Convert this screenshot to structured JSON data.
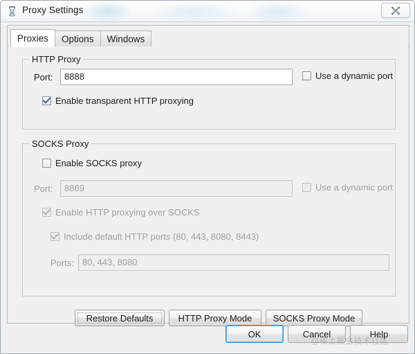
{
  "window": {
    "title": "Proxy Settings",
    "icon": "proxy-app-icon",
    "close_icon": "close-icon"
  },
  "tabs": [
    {
      "label": "Proxies",
      "active": true
    },
    {
      "label": "Options",
      "active": false
    },
    {
      "label": "Windows",
      "active": false
    }
  ],
  "http_proxy": {
    "group_title": "HTTP Proxy",
    "port_label": "Port:",
    "port_value": "8888",
    "dynamic_port": {
      "label": "Use a dynamic port",
      "checked": false,
      "enabled": true
    },
    "transparent": {
      "label": "Enable transparent HTTP proxying",
      "checked": true,
      "enabled": true
    }
  },
  "socks_proxy": {
    "group_title": "SOCKS Proxy",
    "enable": {
      "label": "Enable SOCKS proxy",
      "checked": false,
      "enabled": true
    },
    "port_label": "Port:",
    "port_value": "8889",
    "dynamic_port": {
      "label": "Use a dynamic port",
      "checked": false,
      "enabled": false
    },
    "http_over_socks": {
      "label": "Enable HTTP proxying over SOCKS",
      "checked": true,
      "enabled": false
    },
    "default_ports": {
      "label": "Include default HTTP ports (80, 443, 8080, 8443)",
      "checked": true,
      "enabled": false
    },
    "ports_label": "Ports:",
    "ports_value": "80, 443, 8080"
  },
  "mode_buttons": {
    "restore_defaults": "Restore Defaults",
    "http_proxy_mode": "HTTP Proxy Mode",
    "socks_proxy_mode": "SOCKS Proxy Mode"
  },
  "dialog_buttons": {
    "ok": "OK",
    "cancel": "Cancel",
    "help": "Help"
  },
  "watermark": "@稀土掘金技术社区",
  "colors": {
    "window_bg": "#f0f0f0",
    "accent_focus": "#3c8ed0",
    "check_blue": "#2f5fa8",
    "disabled_text": "#9aa0a6"
  }
}
